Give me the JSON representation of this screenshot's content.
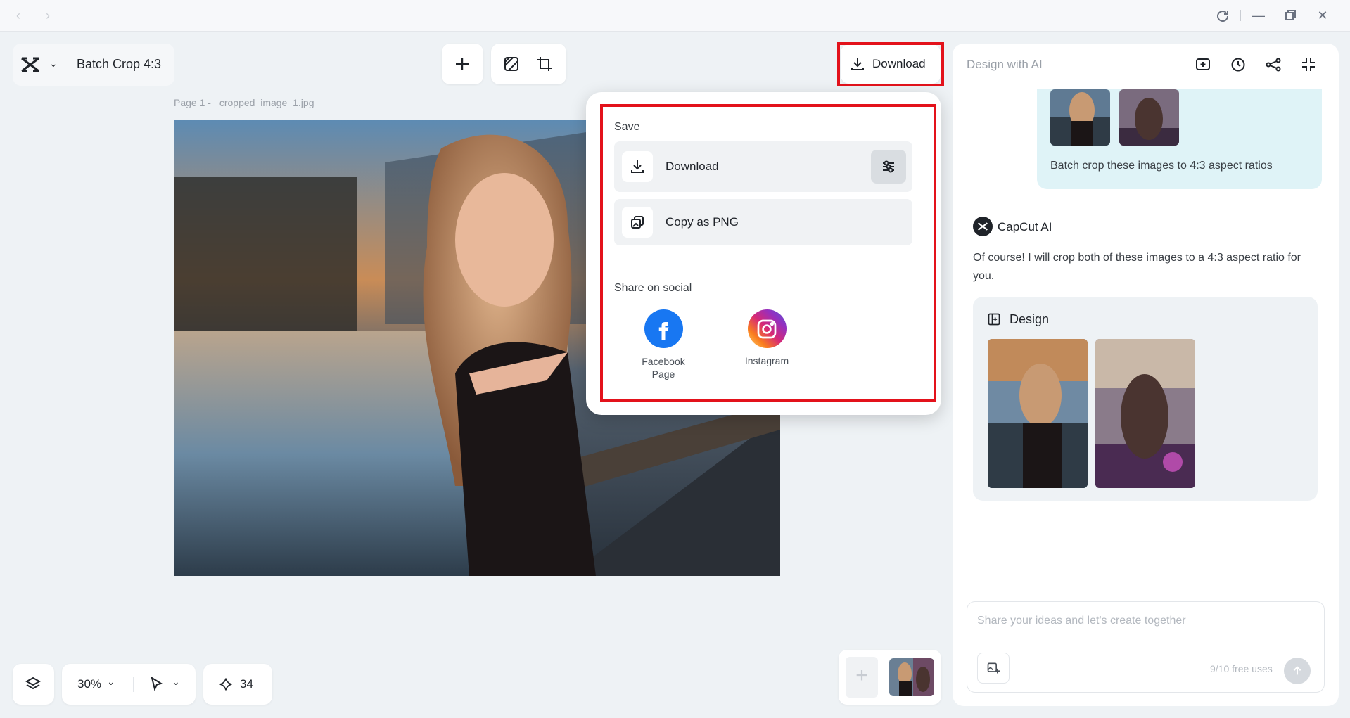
{
  "window": {
    "back_icon": "chevron-left-icon",
    "forward_icon": "chevron-right-icon",
    "controls": [
      "refresh-icon",
      "minimize-icon",
      "restore-icon",
      "close-icon"
    ]
  },
  "project": {
    "title": "Batch Crop 4:3"
  },
  "toolbar": {
    "download_label": "Download"
  },
  "canvas": {
    "page_label": "Page 1 -",
    "file_name": "cropped_image_1.jpg"
  },
  "download_popup": {
    "save_heading": "Save",
    "download_label": "Download",
    "copy_label": "Copy as PNG",
    "share_heading": "Share on social",
    "socials": [
      {
        "label": "Facebook Page",
        "color": "#1877f2"
      },
      {
        "label": "Instagram",
        "color": "#d62976"
      }
    ]
  },
  "bottom_bar": {
    "zoom": "30%",
    "credits": "34"
  },
  "ai_panel": {
    "header": "Design with AI",
    "user_message": "Batch crop these images to 4:3 aspect ratios",
    "assistant_name": "CapCut AI",
    "assistant_message": "Of course! I will crop both of these images to a 4:3 aspect ratio for you.",
    "design_label": "Design",
    "input_placeholder": "Share your ideas and let's create together",
    "usage": "9/10 free uses"
  },
  "colors": {
    "highlight": "#e3121b",
    "bubble": "#dff3f7",
    "facebook": "#1877f2"
  }
}
